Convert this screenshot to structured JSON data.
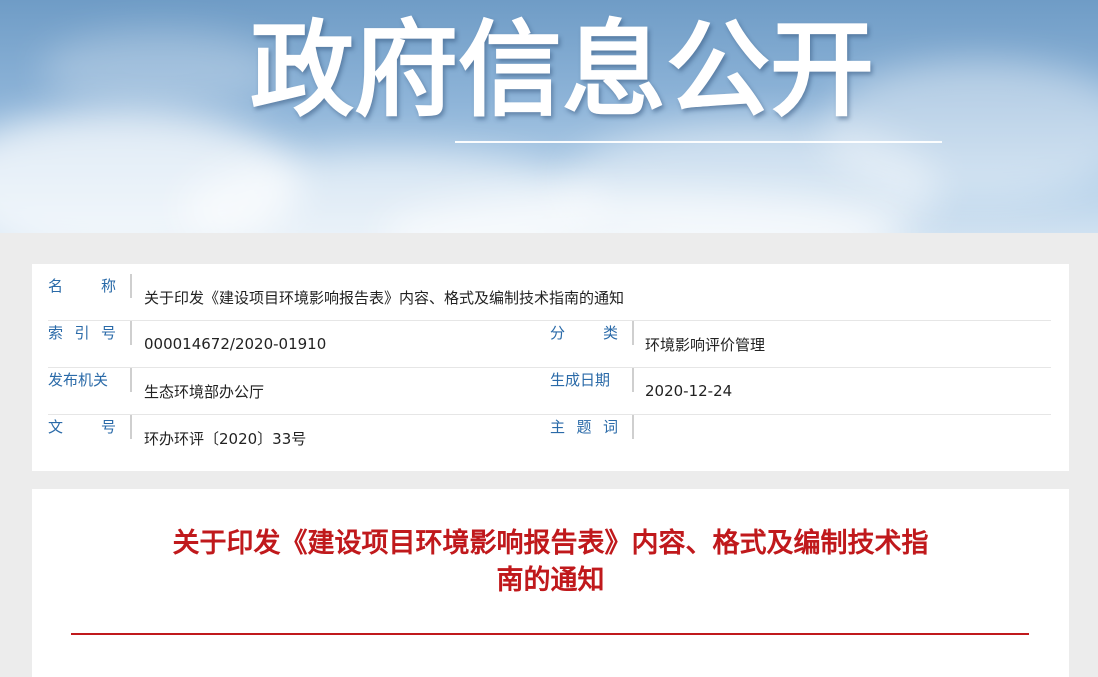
{
  "banner": {
    "title": "政府信息公开"
  },
  "meta": {
    "name_label": [
      "名",
      "称"
    ],
    "name_value": "关于印发《建设项目环境影响报告表》内容、格式及编制技术指南的通知",
    "index_label": [
      "索",
      "引",
      "号"
    ],
    "index_value": "000014672/2020-01910",
    "category_label": [
      "分",
      "类"
    ],
    "category_value": "环境影响评价管理",
    "issuer_label": [
      "发布机关"
    ],
    "issuer_value": "生态环境部办公厅",
    "date_label": [
      "生成日期"
    ],
    "date_value": "2020-12-24",
    "docno_label": [
      "文",
      "号"
    ],
    "docno_value": "环办环评〔2020〕33号",
    "keywords_label": [
      "主",
      "题",
      "词"
    ],
    "keywords_value": ""
  },
  "article": {
    "title_line1": "关于印发《建设项目环境影响报告表》内容、格式及编制技术指",
    "title_line2": "南的通知"
  },
  "colors": {
    "label_blue": "#2a6aa8",
    "title_red": "#c0191c"
  }
}
